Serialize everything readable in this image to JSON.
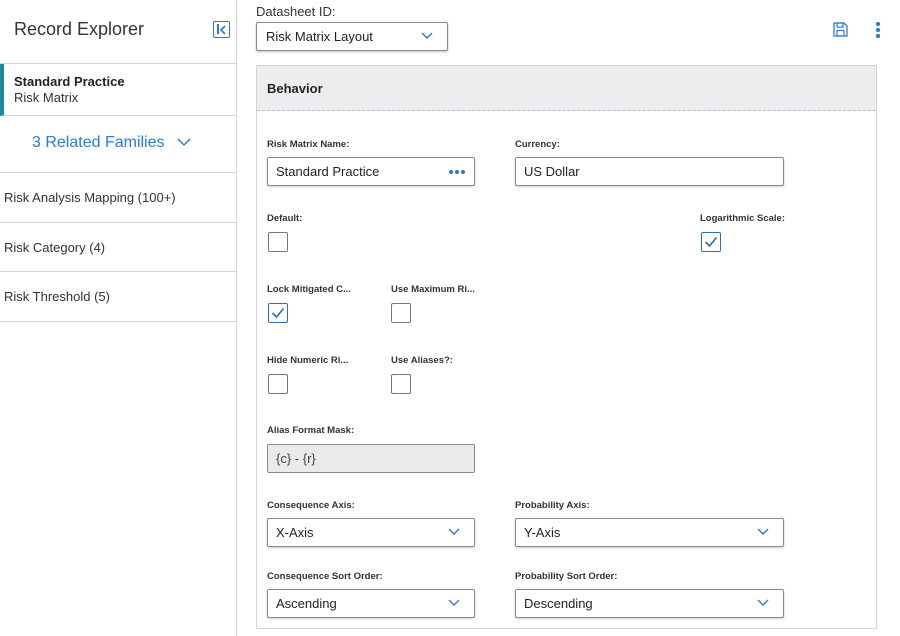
{
  "sidebar": {
    "title": "Record Explorer",
    "record": {
      "title": "Standard Practice",
      "subtitle": "Risk Matrix"
    },
    "related_label": "3 Related Families",
    "items": [
      {
        "label": "Risk Analysis Mapping (100+)"
      },
      {
        "label": "Risk Category (4)"
      },
      {
        "label": "Risk Threshold (5)"
      }
    ]
  },
  "toolbar": {
    "datasheet_label": "Datasheet ID:",
    "datasheet_value": "Risk Matrix Layout"
  },
  "panel": {
    "title": "Behavior",
    "fields": {
      "risk_matrix_name": {
        "label": "Risk Matrix Name:",
        "value": "Standard Practice"
      },
      "currency": {
        "label": "Currency:",
        "value": "US Dollar"
      },
      "default": {
        "label": "Default:",
        "checked": false
      },
      "logarithmic_scale": {
        "label": "Logarithmic Scale:",
        "checked": true
      },
      "lock_mitigated": {
        "label": "Lock Mitigated C...",
        "checked": true
      },
      "use_maximum": {
        "label": "Use Maximum Ri...",
        "checked": false
      },
      "hide_numeric": {
        "label": "Hide Numeric Ri...",
        "checked": false
      },
      "use_aliases": {
        "label": "Use Aliases?:",
        "checked": false
      },
      "alias_format_mask": {
        "label": "Alias Format Mask:",
        "value": "{c} - {r}"
      },
      "consequence_axis": {
        "label": "Consequence Axis:",
        "value": "X-Axis"
      },
      "probability_axis": {
        "label": "Probability Axis:",
        "value": "Y-Axis"
      },
      "consequence_sort": {
        "label": "Consequence Sort Order:",
        "value": "Ascending"
      },
      "probability_sort": {
        "label": "Probability Sort Order:",
        "value": "Descending"
      }
    }
  },
  "colors": {
    "accent": "#2a7bd3",
    "record_marker": "#1a8a9a",
    "panel_header": "#ebedef"
  },
  "icons": [
    "collapse-panel-icon",
    "chevron-down-icon",
    "save-icon",
    "more-vertical-icon",
    "ellipsis-icon",
    "checkmark-icon"
  ]
}
